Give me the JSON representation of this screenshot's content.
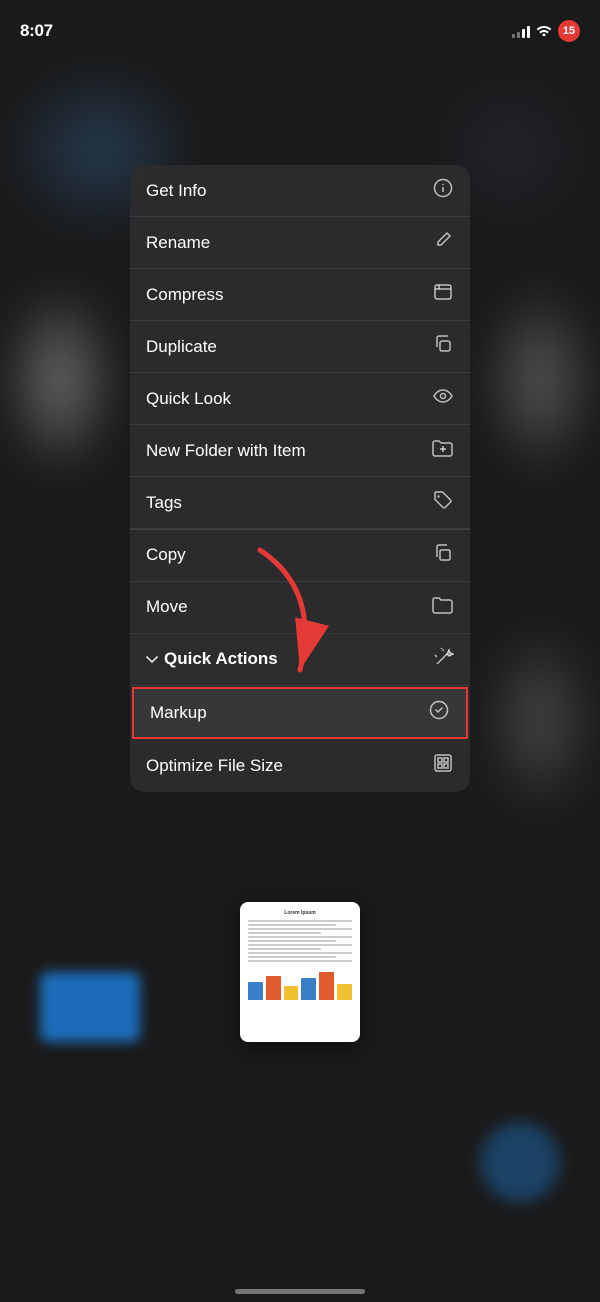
{
  "statusBar": {
    "time": "8:07",
    "batteryNumber": "15"
  },
  "menu": {
    "items": [
      {
        "label": "Get Info",
        "icon": "ℹ",
        "iconType": "circle-info"
      },
      {
        "label": "Rename",
        "icon": "✏",
        "iconType": "pencil"
      },
      {
        "label": "Compress",
        "icon": "⬜",
        "iconType": "compress"
      },
      {
        "label": "Duplicate",
        "icon": "⊞",
        "iconType": "duplicate"
      },
      {
        "label": "Quick Look",
        "icon": "👁",
        "iconType": "eye"
      },
      {
        "label": "New Folder with Item",
        "icon": "📁",
        "iconType": "folder-plus"
      },
      {
        "label": "Tags",
        "icon": "◇",
        "iconType": "tag"
      },
      {
        "label": "Copy",
        "icon": "⧉",
        "iconType": "copy"
      },
      {
        "label": "Move",
        "icon": "🗂",
        "iconType": "folder"
      }
    ],
    "quickActions": {
      "label": "Quick Actions",
      "chevron": "∨",
      "items": [
        {
          "label": "Markup",
          "icon": "⊙",
          "iconType": "markup",
          "highlighted": true
        },
        {
          "label": "Optimize File Size",
          "icon": "⊡",
          "iconType": "optimize"
        }
      ]
    }
  },
  "filePreview": {
    "title": "Lorem Ipsum"
  },
  "colors": {
    "menuBg": "rgba(44,44,46,0.95)",
    "highlightBorder": "#e53935",
    "arrow": "#e53935"
  }
}
